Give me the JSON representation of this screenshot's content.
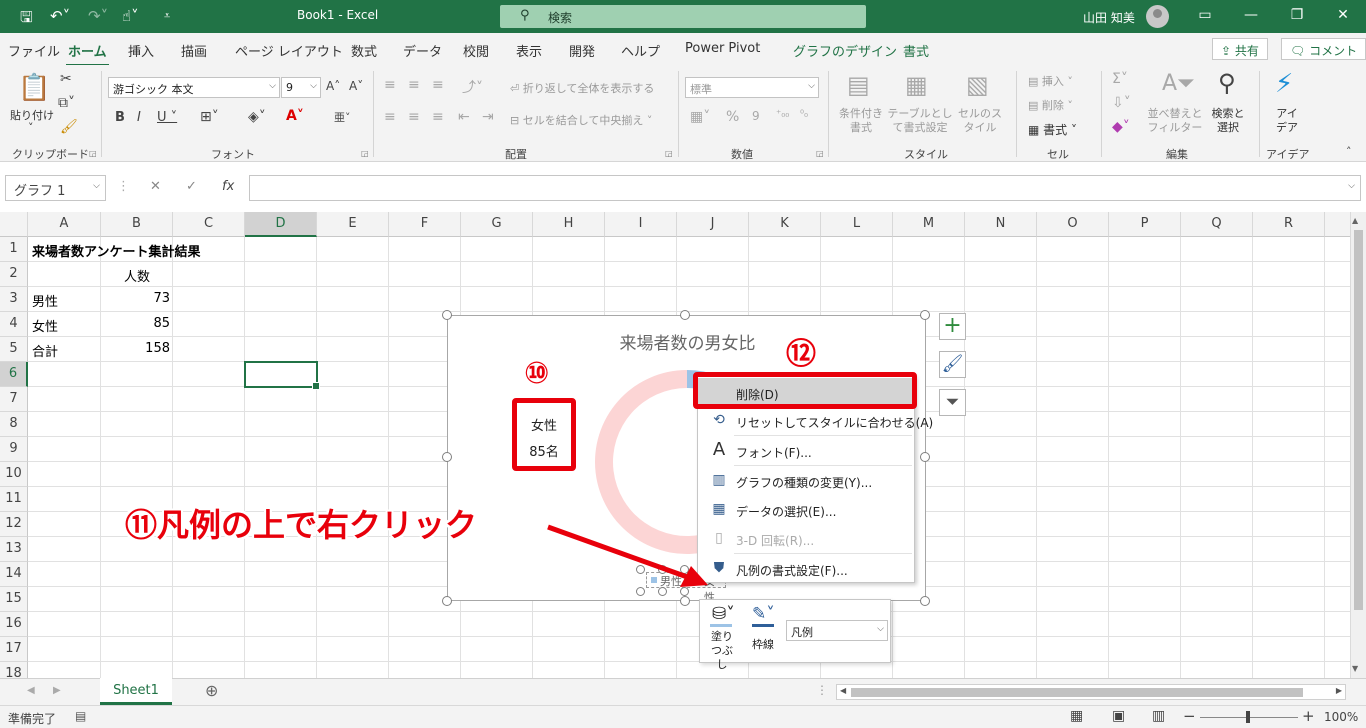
{
  "titlebar": {
    "doc_title": "Book1  -  Excel",
    "search_placeholder": "検索",
    "user_name": "山田 知美"
  },
  "tabs": [
    "ファイル",
    "ホーム",
    "挿入",
    "描画",
    "ページ レイアウト",
    "数式",
    "データ",
    "校閲",
    "表示",
    "開発",
    "ヘルプ",
    "Power Pivot",
    "グラフのデザイン",
    "書式"
  ],
  "share": {
    "share_label": "共有",
    "comment_label": "コメント"
  },
  "ribbon": {
    "clipboard": {
      "paste_label": "貼り付け",
      "group": "クリップボード"
    },
    "font": {
      "font_name": "游ゴシック 本文",
      "font_size": "9",
      "group": "フォント"
    },
    "alignment": {
      "wrap_label": "折り返して全体を表示する",
      "merge_label": "セルを結合して中央揃え",
      "group": "配置"
    },
    "number": {
      "format": "標準",
      "group": "数値"
    },
    "styles": {
      "cond_label": "条件付き書式",
      "table_label": "テーブルとして書式設定",
      "cell_label": "セルのスタイル",
      "group": "スタイル"
    },
    "cells": {
      "insert_label": "挿入",
      "delete_label": "削除",
      "format_label": "書式",
      "group": "セル"
    },
    "editing": {
      "sort_label": "並べ替えとフィルター",
      "find_label": "検索と選択",
      "group": "編集"
    },
    "ideas": {
      "label": "アイデア",
      "group": "アイデア"
    }
  },
  "formula_bar": {
    "name_box": "グラフ 1",
    "fx": "fx",
    "formula": ""
  },
  "columns": [
    "A",
    "B",
    "C",
    "D",
    "E",
    "F",
    "G",
    "H",
    "I",
    "J",
    "K",
    "L",
    "M",
    "N",
    "O",
    "P",
    "Q",
    "R"
  ],
  "rows": [
    "1",
    "2",
    "3",
    "4",
    "5",
    "6",
    "7",
    "8",
    "9",
    "10",
    "11",
    "12",
    "13",
    "14",
    "15",
    "16",
    "17",
    "18"
  ],
  "cells": {
    "a1": "来場者数アンケート集計結果",
    "b2": "人数",
    "a3": "男性",
    "b3": "73",
    "a4": "女性",
    "b4": "85",
    "a5": "合計",
    "b5": "158"
  },
  "chart": {
    "title": "来場者数の男女比",
    "tooltip_line1": "女性",
    "tooltip_line2": "85名",
    "legend_male": "男性",
    "legend_female": "女性"
  },
  "chart_data": {
    "type": "pie",
    "title": "来場者数の男女比",
    "categories": [
      "男性",
      "女性"
    ],
    "values": [
      73,
      85
    ],
    "legend_position": "bottom"
  },
  "context_menu": [
    {
      "label": "削除(D)",
      "icon": "none",
      "highlighted": true
    },
    {
      "label": "リセットしてスタイルに合わせる(A)",
      "icon": "reset-icon"
    },
    {
      "label": "フォント(F)...",
      "icon": "font-icon"
    },
    {
      "label": "グラフの種類の変更(Y)...",
      "icon": "chart-type-icon"
    },
    {
      "label": "データの選択(E)...",
      "icon": "select-data-icon"
    },
    {
      "label": "3-D 回転(R)...",
      "icon": "rotate-3d-icon",
      "disabled": true
    },
    {
      "label": "凡例の書式設定(F)...",
      "icon": "format-legend-icon"
    }
  ],
  "mini_toolbar": {
    "fill_label": "塗りつぶし",
    "outline_label": "枠線",
    "element_select": "凡例"
  },
  "annotations": {
    "badge10": "⑩",
    "badge12": "⑫",
    "caption": "⑪凡例の上で右クリック"
  },
  "sheet_tab": "Sheet1",
  "status": {
    "ready": "準備完了",
    "zoom": "100%"
  },
  "colors": {
    "excel_green": "#217346",
    "annotation_red": "#e8000b",
    "donut_pink": "#fcd5d5",
    "donut_blue": "#9dc3e6"
  }
}
